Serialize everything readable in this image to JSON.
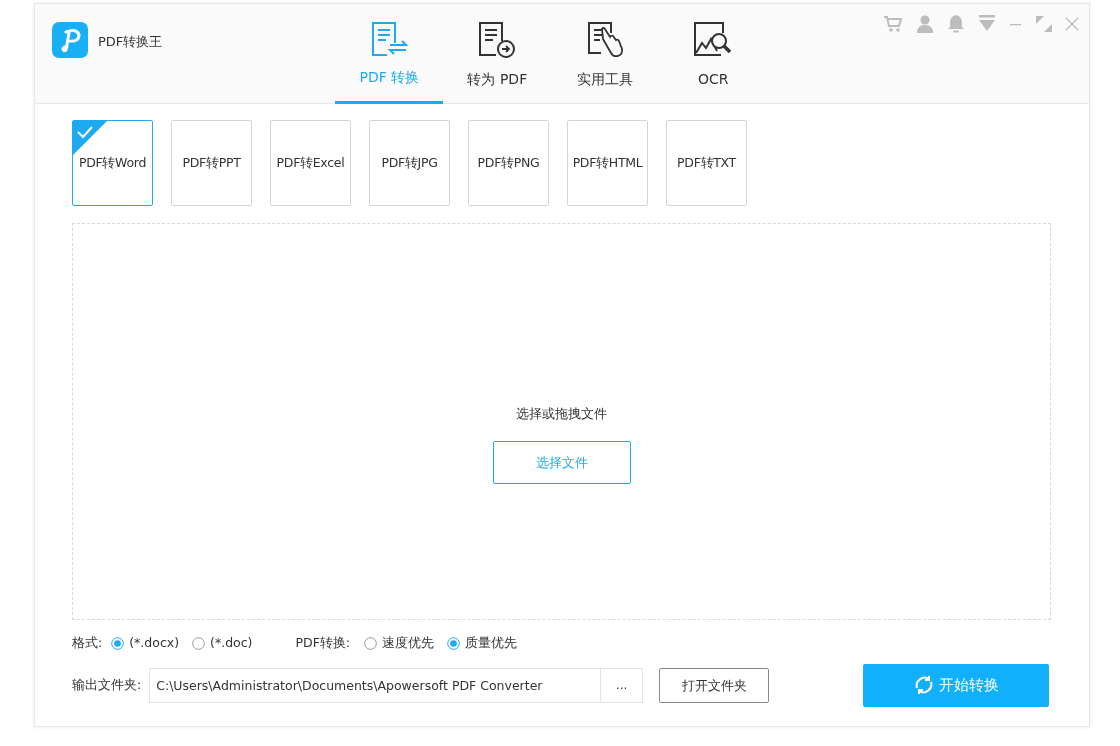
{
  "app": {
    "title": "PDF转换王"
  },
  "tabs": [
    {
      "label": "PDF 转换",
      "selected": true,
      "kind": "convert"
    },
    {
      "label": "转为 PDF",
      "selected": false,
      "kind": "topdf"
    },
    {
      "label": "实用工具",
      "selected": false,
      "kind": "tools"
    },
    {
      "label": "OCR",
      "selected": false,
      "kind": "ocr"
    }
  ],
  "formats": [
    {
      "label": "PDF转Word",
      "selected": true
    },
    {
      "label": "PDF转PPT",
      "selected": false
    },
    {
      "label": "PDF转Excel",
      "selected": false
    },
    {
      "label": "PDF转JPG",
      "selected": false
    },
    {
      "label": "PDF转PNG",
      "selected": false
    },
    {
      "label": "PDF转HTML",
      "selected": false
    },
    {
      "label": "PDF转TXT",
      "selected": false
    }
  ],
  "dropzone": {
    "prompt": "选择或拖拽文件",
    "button": "选择文件"
  },
  "format_option": {
    "label": "格式:",
    "options": [
      {
        "label": "(*.docx)",
        "selected": true
      },
      {
        "label": "(*.doc)",
        "selected": false
      }
    ]
  },
  "conversion_option": {
    "label": "PDF转换:",
    "options": [
      {
        "label": "速度优先",
        "selected": false
      },
      {
        "label": "质量优先",
        "selected": true
      }
    ]
  },
  "output": {
    "label": "输出文件夹:",
    "path": "C:\\Users\\Administrator\\Documents\\Apowersoft PDF Converter",
    "browse": "...",
    "open_folder": "打开文件夹"
  },
  "start_button": "开始转换"
}
